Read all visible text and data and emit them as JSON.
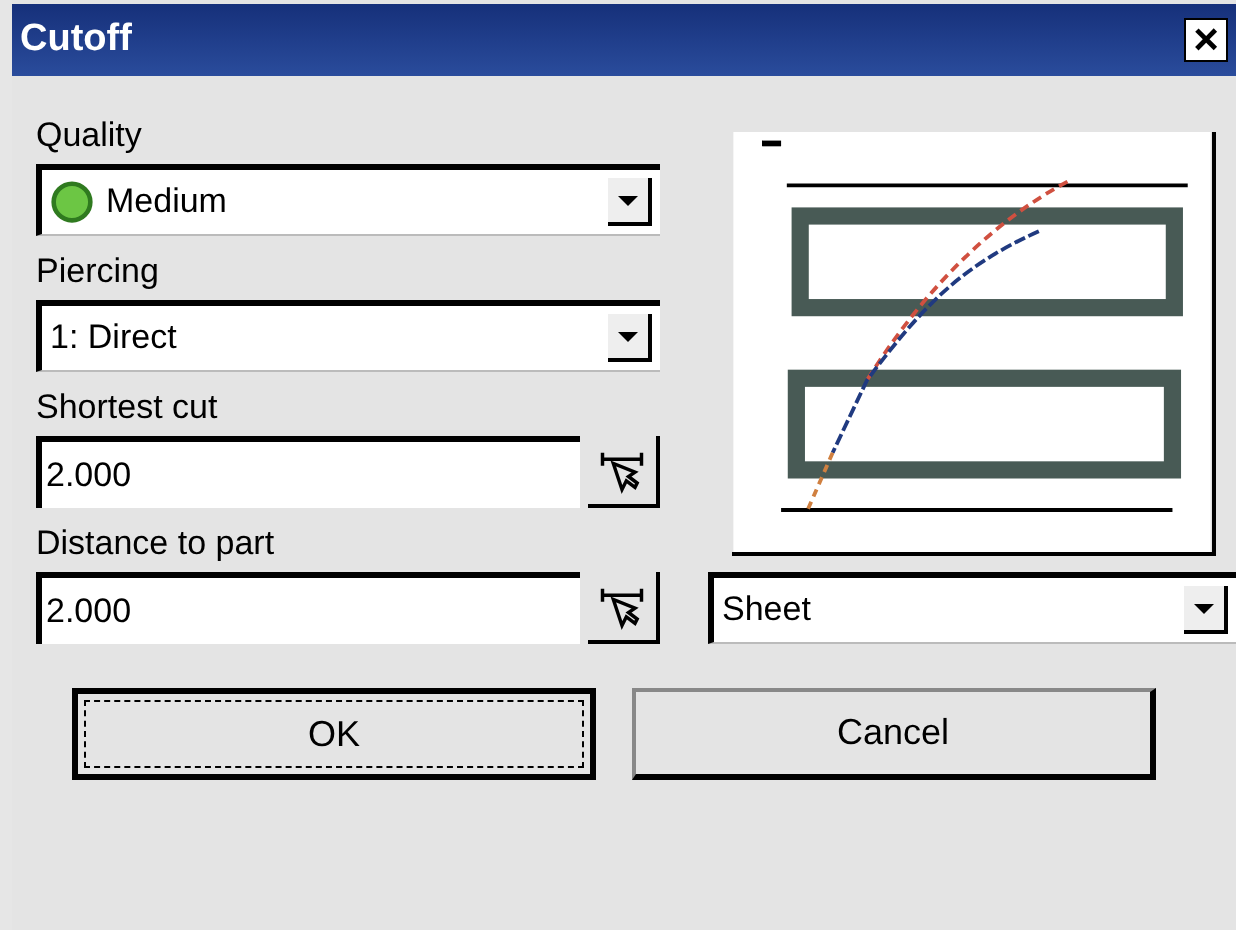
{
  "window": {
    "title": "Cutoff",
    "close": "×"
  },
  "quality": {
    "label": "Quality",
    "value": "Medium"
  },
  "piercing": {
    "label": "Piercing",
    "value": "1: Direct"
  },
  "shortest_cut": {
    "label": "Shortest cut",
    "value": "2.000"
  },
  "distance_to_part": {
    "label": "Distance to part",
    "value": "2.000"
  },
  "view": {
    "value": "Sheet"
  },
  "buttons": [
    {
      "label": "OK",
      "default": true
    },
    {
      "label": "Cancel",
      "default": false
    }
  ]
}
